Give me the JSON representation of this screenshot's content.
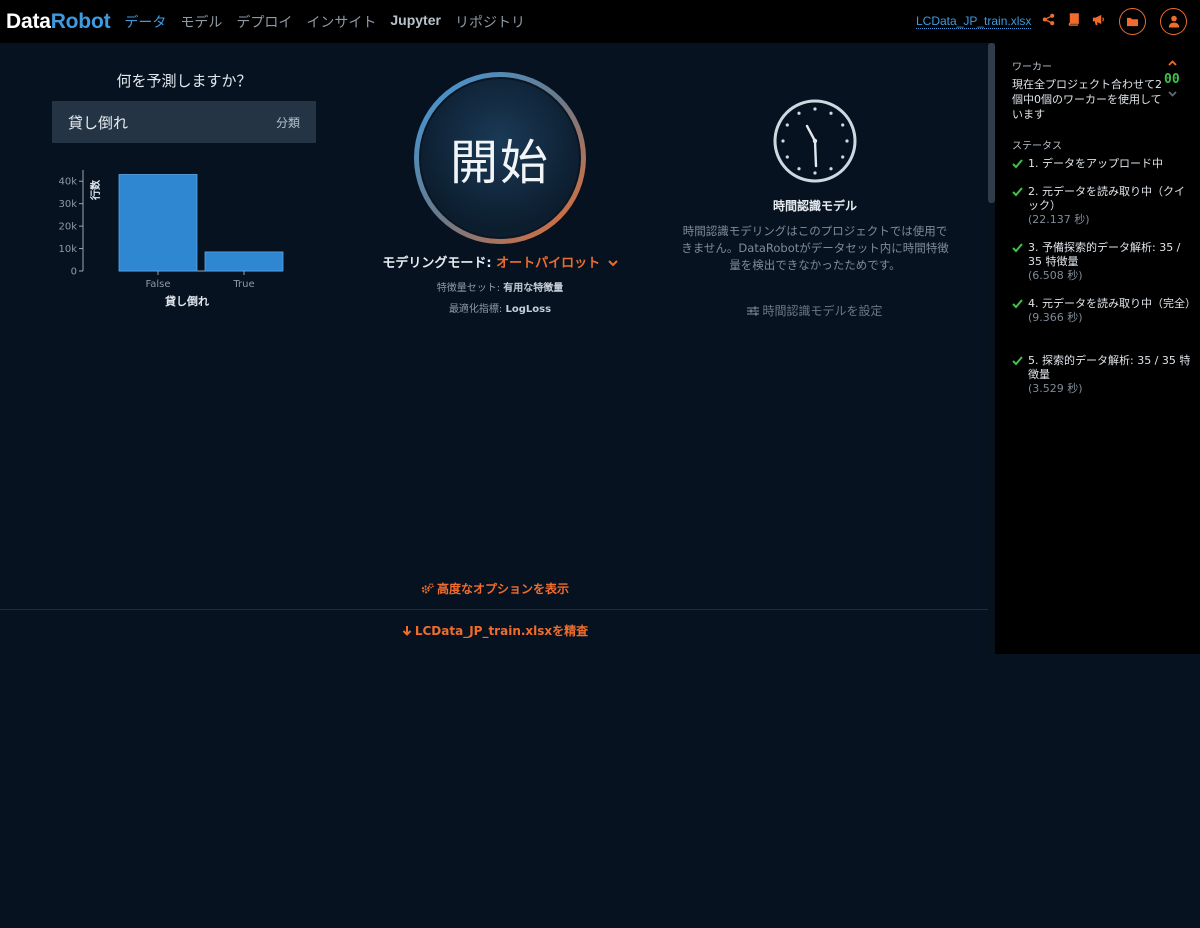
{
  "brand": {
    "logo_part1": "Data",
    "logo_part2": "Robot"
  },
  "nav": {
    "data": "データ",
    "models": "モデル",
    "deploy": "デプロイ",
    "insights": "インサイト",
    "jupyter": "Jupyter",
    "repository": "リポジトリ"
  },
  "header": {
    "filename": "LCData_JP_train.xlsx"
  },
  "target": {
    "question": "何を予測しますか？",
    "name": "貸し倒れ",
    "type": "分類"
  },
  "histogram": {
    "ylabel": "行数",
    "xlabel": "貸し倒れ",
    "yticks": [
      "40k",
      "30k",
      "20k",
      "10k",
      "0"
    ],
    "categories": [
      "False",
      "True"
    ]
  },
  "chart_data": {
    "type": "bar",
    "categories": [
      "False",
      "True"
    ],
    "values": [
      43000,
      8500
    ],
    "xlabel": "貸し倒れ",
    "ylabel": "行数",
    "ylim": [
      0,
      45000
    ],
    "bar_color": "#2f86d1"
  },
  "start": {
    "label": "開始",
    "mode_label": "モデリングモード:",
    "mode_value": "オートパイロット",
    "featureset_label": "特徴量セット:",
    "featureset_value": "有用な特徴量",
    "metric_label": "最適化指標:",
    "metric_value": "LogLoss"
  },
  "time_aware": {
    "title": "時間認識モデル",
    "description": "時間認識モデリングはこのプロジェクトでは使用できません。DataRobotがデータセット内に時間特徴量を検出できなかったためです。",
    "link": "時間認識モデルを設定"
  },
  "advanced_options": "高度なオプションを表示",
  "explore_link": "LCData_JP_train.xlsxを精査",
  "sidebar": {
    "workers_heading": "ワーカー",
    "workers_text": "現在全プロジェクト合わせて2個中0個のワーカーを使用しています",
    "worker_count": "00",
    "status_heading": "ステータス",
    "steps": [
      {
        "text": "1. データをアップロード中",
        "duration": ""
      },
      {
        "text": "2. 元データを読み取り中（クイック）",
        "duration": "(22.137 秒)"
      },
      {
        "text": "3. 予備探索的データ解析: 35 / 35 特徴量",
        "duration": "(6.508 秒)"
      },
      {
        "text": "4. 元データを読み取り中（完全）",
        "duration": "(9.366 秒)"
      },
      {
        "text": "5. 探索的データ解析: 35 / 35 特徴量",
        "duration": "(3.529 秒)"
      }
    ]
  },
  "colors": {
    "accent_blue": "#3e9be0",
    "accent_orange": "#ef6c2d",
    "success_green": "#3ec24a",
    "background": "#06121f"
  }
}
